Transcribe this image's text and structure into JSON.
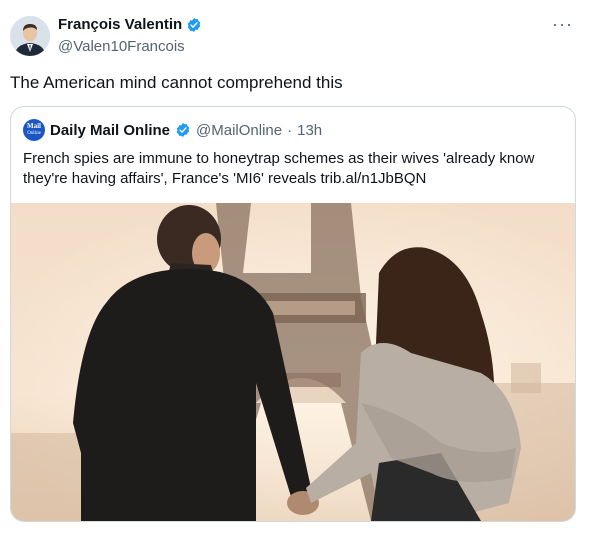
{
  "author": {
    "name": "François Valentin",
    "handle": "@Valen10Francois"
  },
  "tweet": {
    "text": "The American mind cannot comprehend this"
  },
  "quote": {
    "logo_line1": "Mail",
    "logo_line2": "Online",
    "name": "Daily Mail Online",
    "handle": "@MailOnline",
    "separator": "·",
    "time": "13h",
    "text": "French spies are immune to honeytrap schemes as their wives 'already know they're having affairs', France's 'MI6' reveals trib.al/n1JbBQN"
  },
  "icons": {
    "verified": "verified-badge-icon",
    "more": "more-options-icon"
  },
  "colors": {
    "verified": "#1d9bf0",
    "secondary_text": "#536471",
    "border": "#cfd9de"
  },
  "more_label": "···"
}
